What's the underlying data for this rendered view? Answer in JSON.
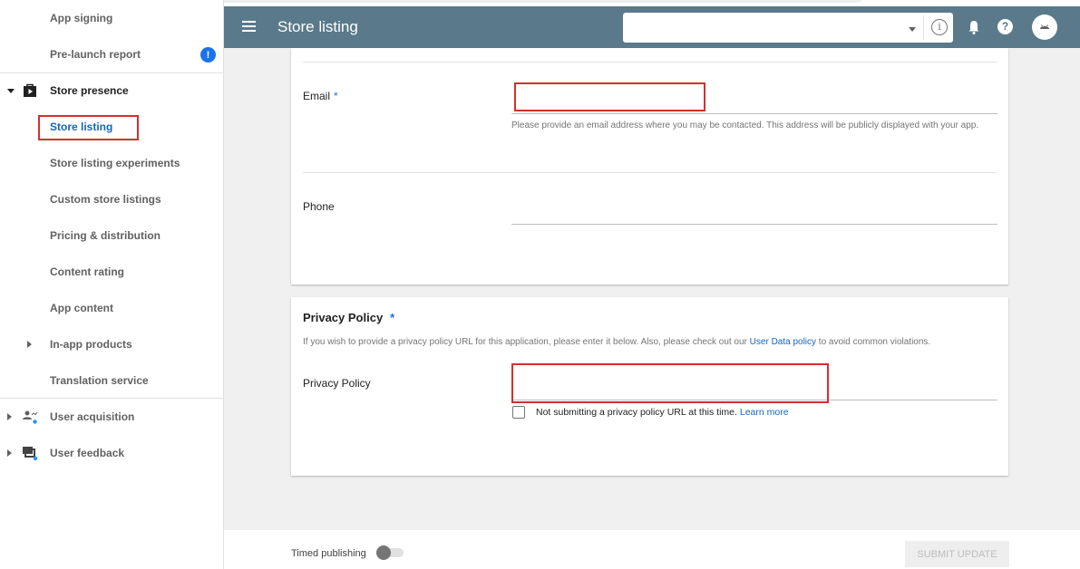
{
  "sidebar": {
    "items": [
      {
        "label": "App signing",
        "type": "child"
      },
      {
        "label": "Pre-launch report",
        "type": "child",
        "badge": "!"
      },
      {
        "label": "Store presence",
        "type": "parent",
        "icon": "store-bag-icon",
        "expanded": true
      },
      {
        "label": "Store listing",
        "type": "child",
        "active": true
      },
      {
        "label": "Store listing experiments",
        "type": "child"
      },
      {
        "label": "Custom store listings",
        "type": "child"
      },
      {
        "label": "Pricing & distribution",
        "type": "child"
      },
      {
        "label": "Content rating",
        "type": "child"
      },
      {
        "label": "App content",
        "type": "child"
      },
      {
        "label": "In-app products",
        "type": "child",
        "expandable": true
      },
      {
        "label": "Translation service",
        "type": "child"
      },
      {
        "label": "User acquisition",
        "type": "section",
        "icon": "user-acquisition-icon",
        "expandable": true
      },
      {
        "label": "User feedback",
        "type": "section",
        "icon": "user-feedback-icon",
        "expandable": true
      }
    ]
  },
  "header": {
    "title": "Store listing",
    "app_selector_value": "",
    "info_glyph": "i",
    "help_glyph": "?"
  },
  "contact": {
    "email_label": "Email",
    "email_required": "*",
    "email_value": "",
    "email_help": "Please provide an email address where you may be contacted. This address will be publicly displayed with your app.",
    "phone_label": "Phone",
    "phone_value": ""
  },
  "privacy": {
    "title": "Privacy Policy",
    "required": "*",
    "desc_before": "If you wish to provide a privacy policy URL for this application, please enter it below. Also, please check out our ",
    "desc_link": "User Data policy",
    "desc_after": " to avoid common violations.",
    "field_label": "Privacy Policy",
    "field_value": "",
    "checkbox_label": "Not submitting a privacy policy URL at this time.",
    "checkbox_link": "Learn more",
    "checkbox_checked": false
  },
  "footer": {
    "timed_publishing_label": "Timed publishing",
    "timed_publishing_on": false,
    "submit_label": "SUBMIT UPDATE"
  },
  "colors": {
    "header_bg": "#5a7a8b",
    "accent": "#1565c0",
    "highlight": "#d32f2f",
    "badge": "#1a73e8"
  }
}
